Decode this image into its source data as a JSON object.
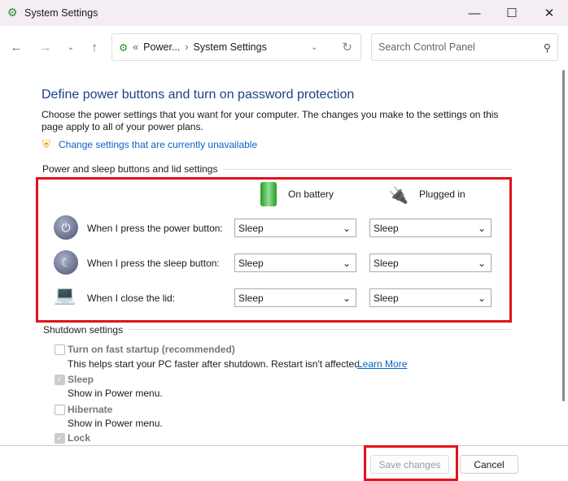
{
  "window": {
    "title": "System Settings"
  },
  "nav": {
    "breadcrumb_prev": "Power...",
    "breadcrumb_current": "System Settings",
    "search_placeholder": "Search Control Panel"
  },
  "main": {
    "title": "Define power buttons and turn on password protection",
    "description": "Choose the power settings that you want for your computer. The changes you make to the settings on this page apply to all of your power plans.",
    "change_link": "Change settings that are currently unavailable",
    "buttons_section": "Power and sleep buttons and lid settings",
    "col_battery": "On battery",
    "col_plugged": "Plugged in",
    "rows": [
      {
        "label": "When I press the power button:",
        "battery": "Sleep",
        "plugged": "Sleep"
      },
      {
        "label": "When I press the sleep button:",
        "battery": "Sleep",
        "plugged": "Sleep"
      },
      {
        "label": "When I close the lid:",
        "battery": "Sleep",
        "plugged": "Sleep"
      }
    ],
    "shutdown_section": "Shutdown settings",
    "shutdown": [
      {
        "label": "Turn on fast startup (recommended)",
        "desc": "This helps start your PC faster after shutdown. Restart isn't affected.",
        "link": "Learn More",
        "checked": false
      },
      {
        "label": "Sleep",
        "desc": "Show in Power menu.",
        "checked": true
      },
      {
        "label": "Hibernate",
        "desc": "Show in Power menu.",
        "checked": false
      },
      {
        "label": "Lock",
        "checked": true
      }
    ]
  },
  "footer": {
    "save": "Save changes",
    "cancel": "Cancel"
  }
}
